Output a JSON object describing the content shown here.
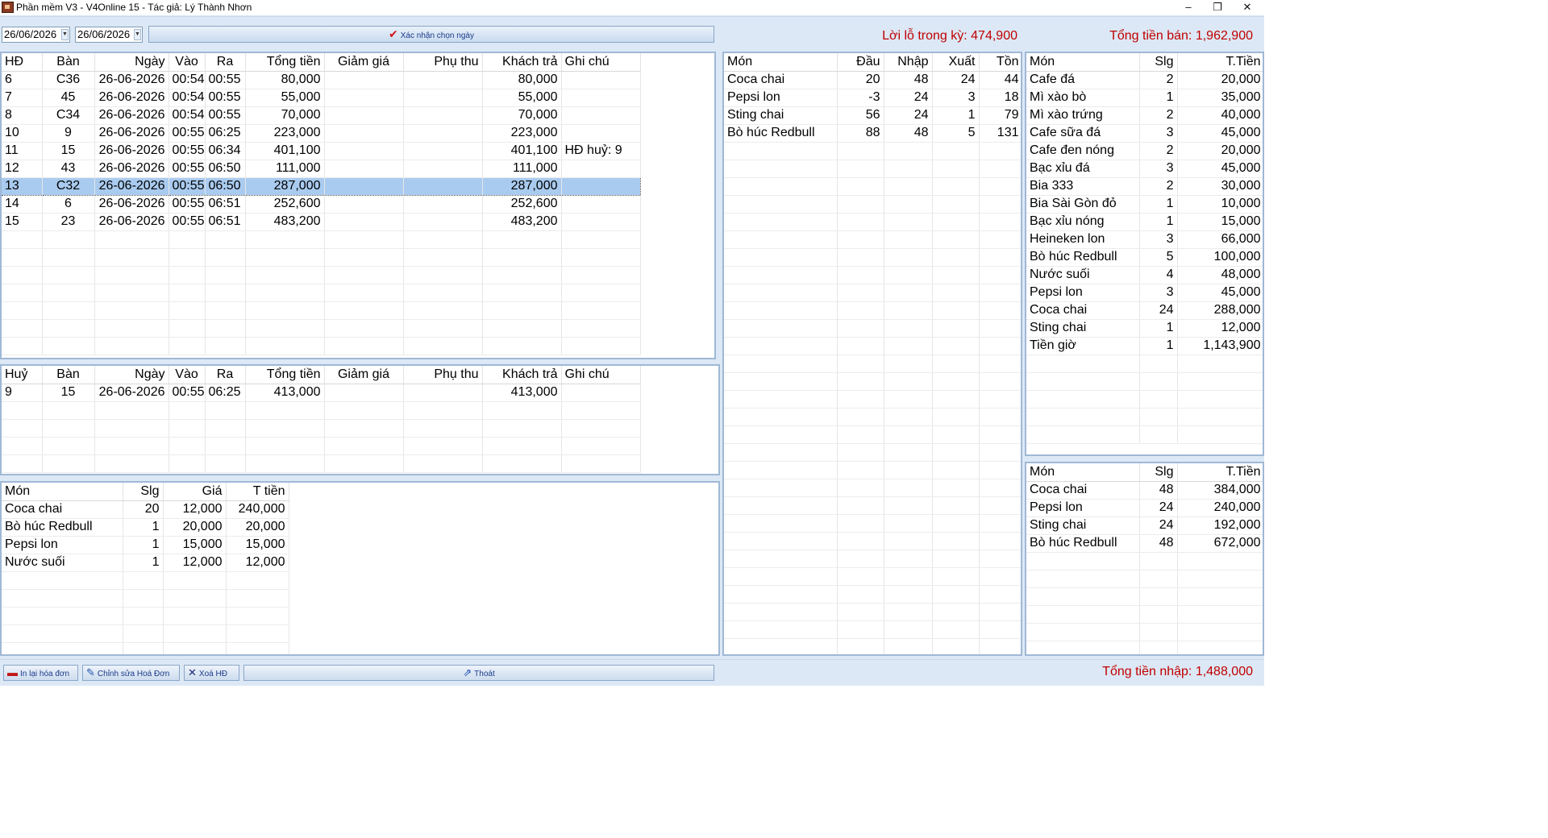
{
  "window": {
    "title": "Phần mềm V3 - V4Online 15 - Tác giả: Lý Thành Nhơn",
    "minimize": "–",
    "restore": "❐",
    "close": "✕"
  },
  "toolbar": {
    "date_from": "26/06/2026",
    "date_to": "26/06/2026",
    "confirm_label": "Xác nhận chọn ngày",
    "confirm_icon": "✔",
    "profit_label": "Lời lỗ trong kỳ: 474,900",
    "sales_total_label": "Tổng tiền bán: 1,962,900"
  },
  "invoices": {
    "headers": [
      "HĐ",
      "Bàn",
      "Ngày",
      "Vào",
      "Ra",
      "Tổng tiền",
      "Giảm giá",
      "Phụ thu",
      "Khách trả",
      "Ghi chú"
    ],
    "rows": [
      [
        "6",
        "C36",
        "26-06-2026",
        "00:54",
        "00:55",
        "80,000",
        "",
        "",
        "80,000",
        ""
      ],
      [
        "7",
        "45",
        "26-06-2026",
        "00:54",
        "00:55",
        "55,000",
        "",
        "",
        "55,000",
        ""
      ],
      [
        "8",
        "C34",
        "26-06-2026",
        "00:54",
        "00:55",
        "70,000",
        "",
        "",
        "70,000",
        ""
      ],
      [
        "10",
        "9",
        "26-06-2026",
        "00:55",
        "06:25",
        "223,000",
        "",
        "",
        "223,000",
        ""
      ],
      [
        "11",
        "15",
        "26-06-2026",
        "00:55",
        "06:34",
        "401,100",
        "",
        "",
        "401,100",
        "HĐ huỷ: 9"
      ],
      [
        "12",
        "43",
        "26-06-2026",
        "00:55",
        "06:50",
        "111,000",
        "",
        "",
        "111,000",
        ""
      ],
      [
        "13",
        "C32",
        "26-06-2026",
        "00:55",
        "06:50",
        "287,000",
        "",
        "",
        "287,000",
        ""
      ],
      [
        "14",
        "6",
        "26-06-2026",
        "00:55",
        "06:51",
        "252,600",
        "",
        "",
        "252,600",
        ""
      ],
      [
        "15",
        "23",
        "26-06-2026",
        "00:55",
        "06:51",
        "483,200",
        "",
        "",
        "483,200",
        ""
      ]
    ],
    "selected_index": 6
  },
  "cancelled": {
    "headers": [
      "Huỷ",
      "Bàn",
      "Ngày",
      "Vào",
      "Ra",
      "Tổng tiền",
      "Giảm giá",
      "Phụ thu",
      "Khách trả",
      "Ghi chú"
    ],
    "rows": [
      [
        "9",
        "15",
        "26-06-2026",
        "00:55",
        "06:25",
        "413,000",
        "",
        "",
        "413,000",
        ""
      ]
    ]
  },
  "invoice_detail": {
    "headers": [
      "Món",
      "Slg",
      "Giá",
      "T tiền"
    ],
    "rows": [
      [
        "Coca chai",
        "20",
        "12,000",
        "240,000"
      ],
      [
        "Bò húc Redbull",
        "1",
        "20,000",
        "20,000"
      ],
      [
        "Pepsi lon",
        "1",
        "15,000",
        "15,000"
      ],
      [
        "Nước suối",
        "1",
        "12,000",
        "12,000"
      ]
    ]
  },
  "inventory": {
    "headers": [
      "Món",
      "Đầu",
      "Nhập",
      "Xuất",
      "Tồn"
    ],
    "rows": [
      [
        "Coca chai",
        "20",
        "48",
        "24",
        "44"
      ],
      [
        "Pepsi lon",
        "-3",
        "24",
        "3",
        "18"
      ],
      [
        "Sting chai",
        "56",
        "24",
        "1",
        "79"
      ],
      [
        "Bò húc Redbull",
        "88",
        "48",
        "5",
        "131"
      ]
    ]
  },
  "sales_summary": {
    "headers": [
      "Món",
      "Slg",
      "T.Tiền"
    ],
    "rows": [
      [
        "Cafe đá",
        "2",
        "20,000"
      ],
      [
        "Mì xào bò",
        "1",
        "35,000"
      ],
      [
        "Mì xào trứng",
        "2",
        "40,000"
      ],
      [
        "Cafe sữa đá",
        "3",
        "45,000"
      ],
      [
        "Cafe đen nóng",
        "2",
        "20,000"
      ],
      [
        "Bạc xỉu đá",
        "3",
        "45,000"
      ],
      [
        "Bia 333",
        "2",
        "30,000"
      ],
      [
        "Bia Sài Gòn đỏ",
        "1",
        "10,000"
      ],
      [
        "Bạc xỉu nóng",
        "1",
        "15,000"
      ],
      [
        "Heineken lon",
        "3",
        "66,000"
      ],
      [
        "Bò húc Redbull",
        "5",
        "100,000"
      ],
      [
        "Nước suối",
        "4",
        "48,000"
      ],
      [
        "Pepsi lon",
        "3",
        "45,000"
      ],
      [
        "Coca chai",
        "24",
        "288,000"
      ],
      [
        "Sting chai",
        "1",
        "12,000"
      ],
      [
        "Tiền giờ",
        "1",
        "1,143,900"
      ]
    ]
  },
  "import_summary": {
    "headers": [
      "Món",
      "Slg",
      "T.Tiền"
    ],
    "rows": [
      [
        "Coca chai",
        "48",
        "384,000"
      ],
      [
        "Pepsi lon",
        "24",
        "240,000"
      ],
      [
        "Sting chai",
        "24",
        "192,000"
      ],
      [
        "Bò húc Redbull",
        "48",
        "672,000"
      ]
    ]
  },
  "bottombar": {
    "reprint_label": "In lại hóa đơn",
    "reprint_icon": "printer-icon",
    "edit_label": "Chỉnh sửa Hoá Đơn",
    "edit_icon": "edit-icon",
    "delete_label": "Xoá HĐ",
    "delete_icon": "x-icon",
    "exit_label": "Thoát",
    "exit_icon": "share-icon",
    "import_total_label": "Tổng tiền nhập: 1,488,000"
  }
}
